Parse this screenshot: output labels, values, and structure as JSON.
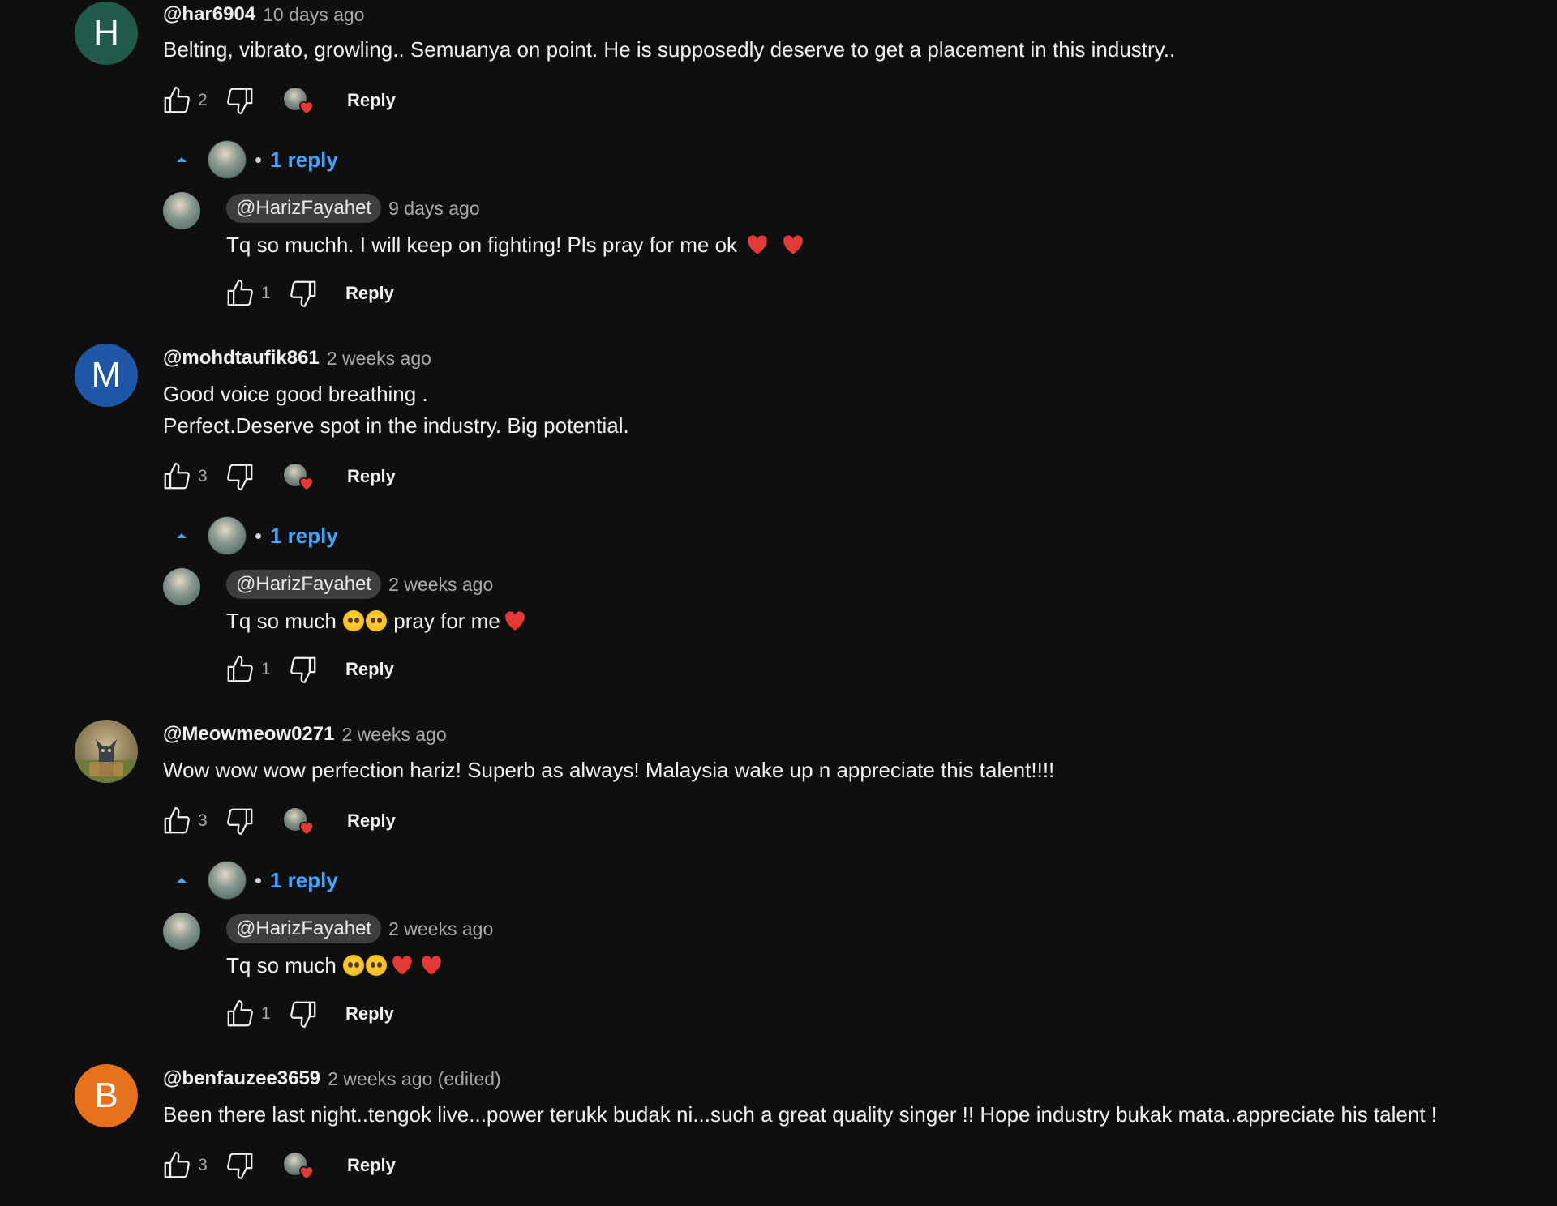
{
  "comments": [
    {
      "avatar_letter": "H",
      "avatar_color": "#1f5a4a",
      "author": "@har6904",
      "time": "10 days ago",
      "lines": [
        "Belting, vibrato, growling.. Semuanya on point. He is supposedly deserve to get a placement in this industry.."
      ],
      "likes": "2",
      "reply_label": "Reply",
      "replies_toggle": "1 reply",
      "reply": {
        "author": "@HarizFayahet",
        "time": "9 days ago",
        "text_parts": [
          "Tq so muchh. I will keep on fighting! Pls pray for me ok"
        ],
        "emoji": [
          "heart",
          "heart"
        ],
        "likes": "1",
        "reply_label": "Reply"
      }
    },
    {
      "avatar_letter": "M",
      "avatar_color": "#1f56a8",
      "author": "@mohdtaufik861",
      "time": "2 weeks ago",
      "lines": [
        "Good voice good breathing .",
        "Perfect.Deserve spot in the industry. Big potential."
      ],
      "likes": "3",
      "reply_label": "Reply",
      "replies_toggle": "1 reply",
      "reply": {
        "author": "@HarizFayahet",
        "time": "2 weeks ago",
        "text_before": "Tq so much",
        "text_after": "pray for me",
        "likes": "1",
        "reply_label": "Reply"
      }
    },
    {
      "avatar_kind": "cat-photo",
      "author": "@Meowmeow0271",
      "time": "2 weeks ago",
      "lines": [
        "Wow wow wow perfection hariz! Superb as always! Malaysia wake up n appreciate this talent!!!!"
      ],
      "likes": "3",
      "reply_label": "Reply",
      "replies_toggle": "1 reply",
      "reply": {
        "author": "@HarizFayahet",
        "time": "2 weeks ago",
        "text_before": "Tq so much",
        "likes": "1",
        "reply_label": "Reply"
      }
    },
    {
      "avatar_letter": "B",
      "avatar_color": "#e8711c",
      "author": "@benfauzee3659",
      "time": "2 weeks ago (edited)",
      "lines": [
        "Been there last night..tengok live...power terukk budak ni...such a great quality singer !! Hope industry bukak mata..appreciate his talent !"
      ],
      "likes": "3",
      "reply_label": "Reply"
    }
  ],
  "colors": {
    "background": "#0f0f0f",
    "link_blue": "#3ea6ff",
    "heart_red": "#e53935",
    "secondary_text": "#aaaaaa"
  },
  "icons": [
    "thumb-up-icon",
    "thumb-down-icon",
    "creator-heart-icon",
    "caret-up-icon",
    "heart-emoji",
    "pleading-face-emoji"
  ]
}
